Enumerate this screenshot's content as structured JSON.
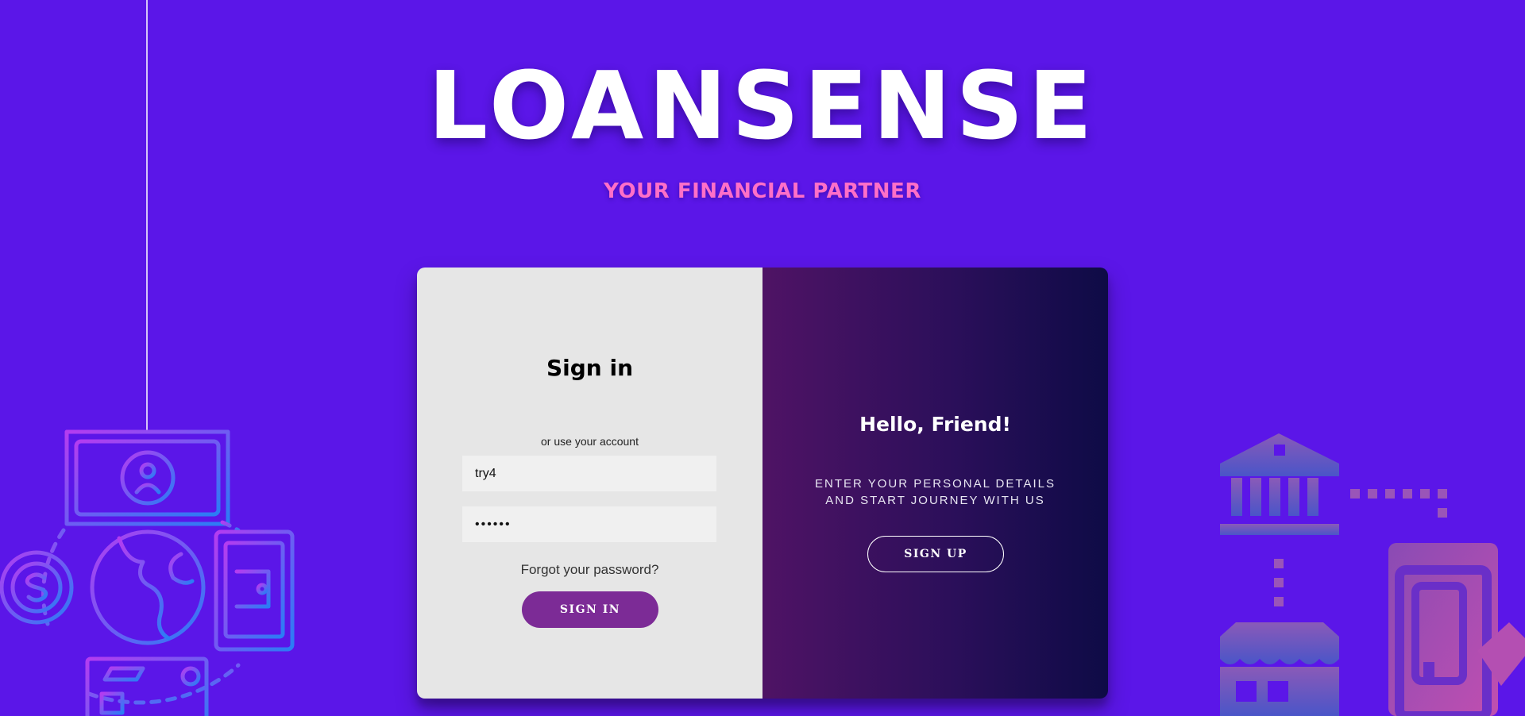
{
  "brand": {
    "logo_text": "LOANSENSE",
    "tagline": "YOUR FINANCIAL PARTNER"
  },
  "signin_panel": {
    "title": "Sign in",
    "alt_text": "or use your account",
    "username_value": "try4",
    "password_value": "••••••",
    "forgot_link": "Forgot your password?",
    "signin_button": "SIGN IN"
  },
  "signup_panel": {
    "title": "Hello, Friend!",
    "subtitle": "ENTER YOUR PERSONAL DETAILS AND START JOURNEY WITH US",
    "signup_button": "SIGN UP"
  },
  "decorations": {
    "left_icons": [
      "banknote-icon",
      "coin-dollar-icon",
      "globe-icon",
      "wallet-icon",
      "credit-card-icon"
    ],
    "right_icons": [
      "bank-icon",
      "store-icon",
      "phone-payment-icon"
    ]
  },
  "colors": {
    "background": "#5b16e8",
    "tagline": "#ff6fc8",
    "signin_button": "#7c2b96",
    "panel_left": "#e6e6e6",
    "panel_right_start": "#4f1365",
    "panel_right_end": "#0e0b46"
  }
}
